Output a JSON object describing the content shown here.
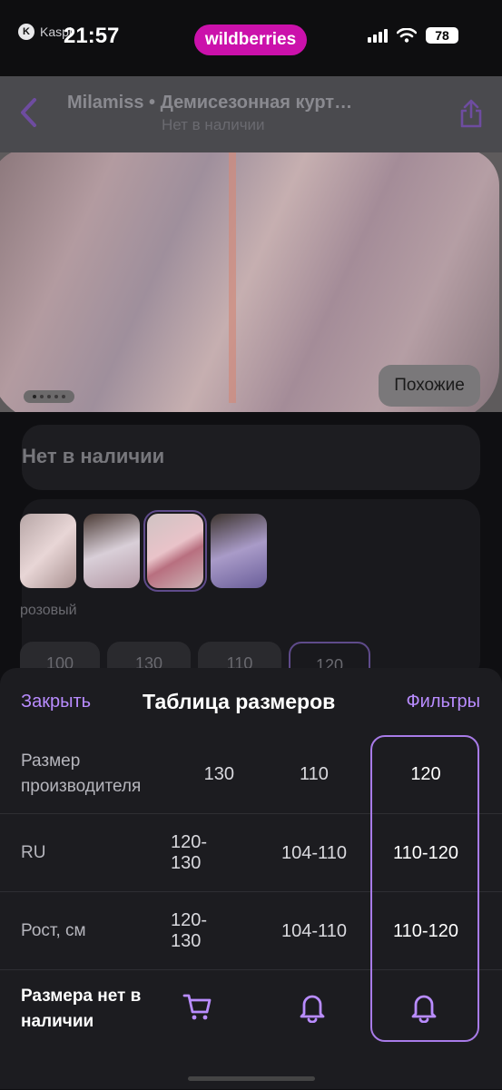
{
  "status_bar": {
    "app_label": "Kaspi",
    "time": "21:57",
    "brand": "wildberries",
    "battery": "78"
  },
  "product": {
    "title": "Milamiss • Демисезонная курт…",
    "subtitle": "Нет в наличии",
    "similar_label": "Похожие",
    "out_of_stock": "Нет в наличии",
    "color_name": "розовый",
    "sizes": [
      "100",
      "130",
      "110",
      "120"
    ],
    "selected_size": "120"
  },
  "sheet": {
    "close_label": "Закрыть",
    "title": "Таблица размеров",
    "filters_label": "Фильтры",
    "rows": [
      {
        "label": "Размер производителя",
        "values": [
          "130",
          "110",
          "120"
        ]
      },
      {
        "label": "RU",
        "values": [
          "120-130",
          "104-110",
          "110-120"
        ]
      },
      {
        "label": "Рост, см",
        "values": [
          "120-130",
          "104-110",
          "110-120"
        ]
      }
    ],
    "availability_label": "Размера нет в наличии",
    "row_icons": [
      "cart-icon",
      "bell-icon",
      "bell-icon"
    ]
  },
  "colors": {
    "accent": "#b98cff",
    "brand": "#cb11ab",
    "sheet_bg": "#1c1c20"
  }
}
